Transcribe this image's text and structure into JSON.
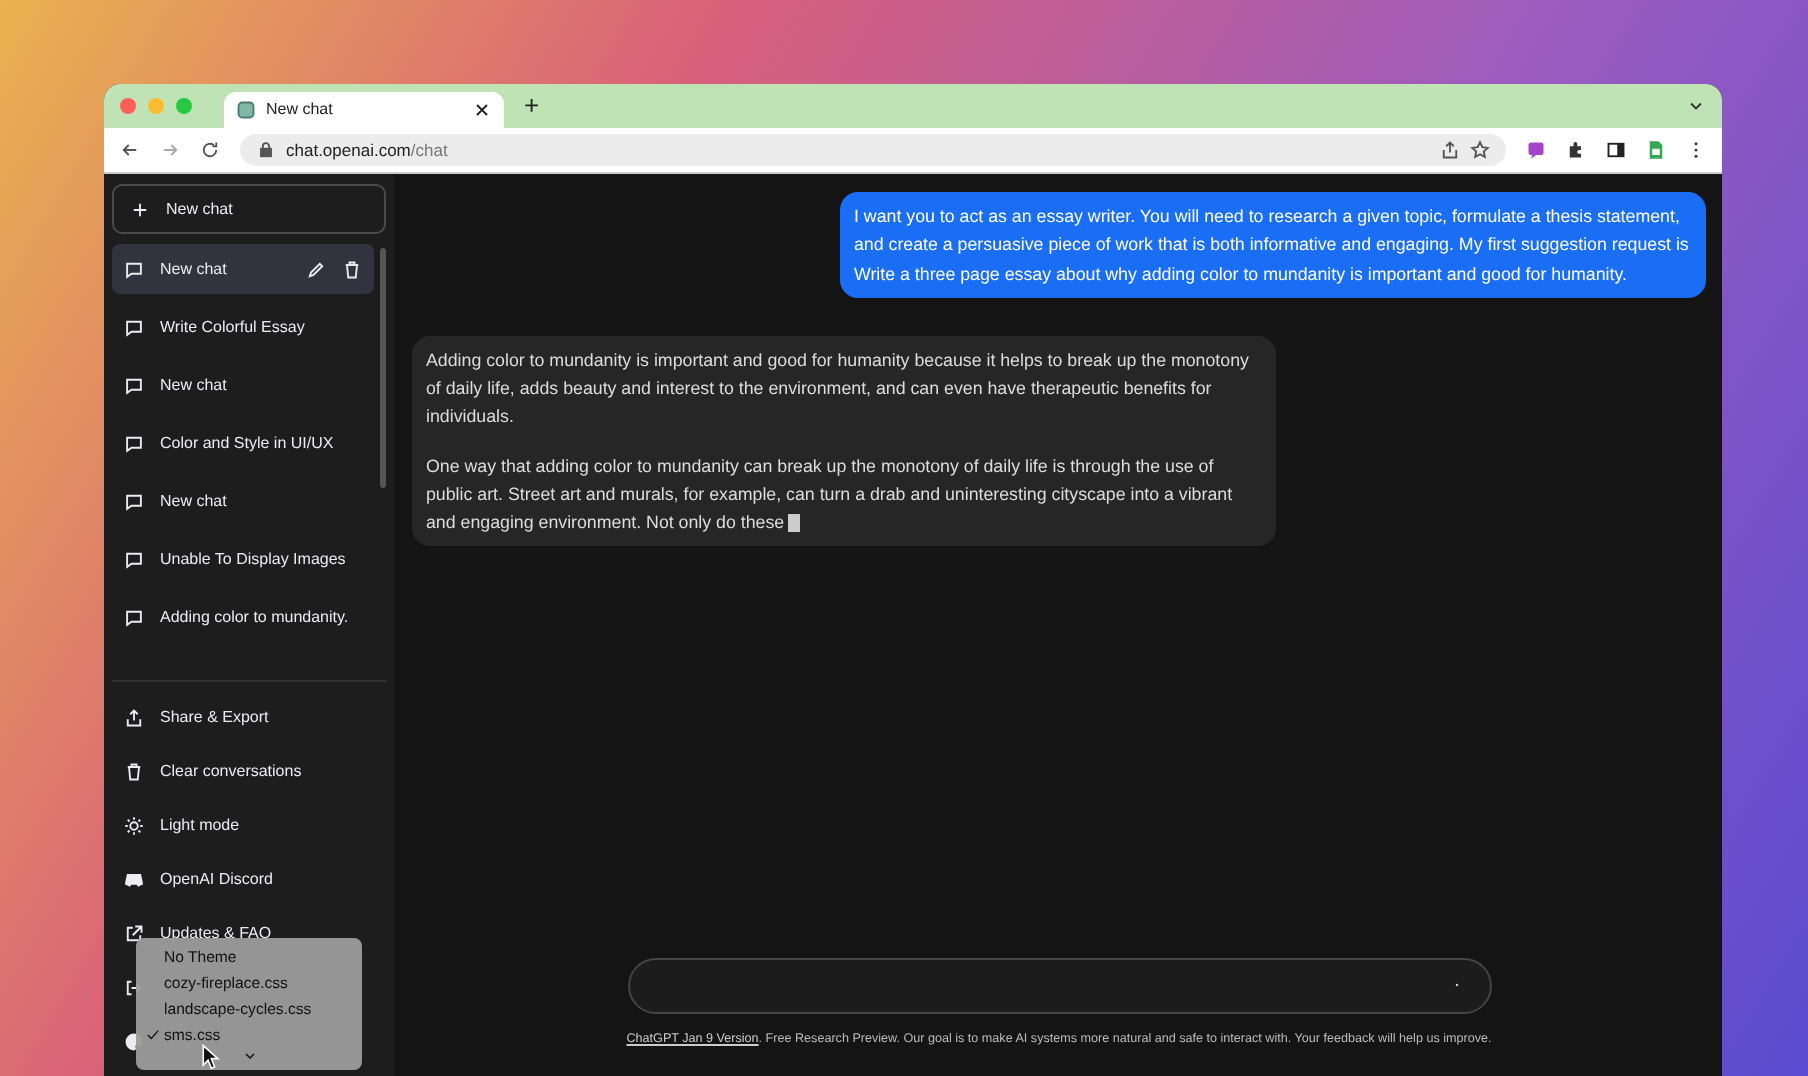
{
  "browser": {
    "tab_title": "New chat",
    "new_tab": "+",
    "url_host": "chat.openai.com",
    "url_path": "/chat"
  },
  "sidebar": {
    "new_chat_button": "New chat",
    "chats": [
      {
        "title": "New chat",
        "selected": true
      },
      {
        "title": "Write Colorful Essay",
        "selected": false
      },
      {
        "title": "New chat",
        "selected": false
      },
      {
        "title": "Color and Style in UI/UX",
        "selected": false
      },
      {
        "title": "New chat",
        "selected": false
      },
      {
        "title": "Unable To Display Images",
        "selected": false
      },
      {
        "title": "Adding color to mundanity.",
        "selected": false
      }
    ],
    "menu": [
      {
        "kind": "share",
        "label": "Share & Export"
      },
      {
        "kind": "trash",
        "label": "Clear conversations"
      },
      {
        "kind": "sun",
        "label": "Light mode"
      },
      {
        "kind": "discord",
        "label": "OpenAI Discord"
      },
      {
        "kind": "link",
        "label": "Updates & FAQ"
      },
      {
        "kind": "logout"
      },
      {
        "kind": "palette"
      }
    ]
  },
  "theme_menu": {
    "options": [
      {
        "label": "No Theme",
        "selected": false
      },
      {
        "label": "cozy-fireplace.css",
        "selected": false
      },
      {
        "label": "landscape-cycles.css",
        "selected": false
      },
      {
        "label": "sms.css",
        "selected": true
      }
    ]
  },
  "messages": [
    {
      "kind": "user",
      "typing": false,
      "paragraphs": [
        "I want you to act as an essay writer. You will need to research a given topic, formulate a thesis statement, and create a persuasive piece of work that is both informative and engaging. My first suggestion request is Write a three page essay about why adding color to mundanity is important and good for humanity."
      ]
    },
    {
      "kind": "assistant",
      "typing": true,
      "paragraphs": [
        "Adding color to mundanity is important and good for humanity because it helps to break up the monotony of daily life, adds beauty and interest to the environment, and can even have therapeutic benefits for individuals.",
        "One way that adding color to mundanity can break up the monotony of daily life is through the use of public art. Street art and murals, for example, can turn a drab and uninteresting cityscape into a vibrant and engaging environment. Not only do these"
      ]
    }
  ],
  "footer": {
    "link": "ChatGPT Jan 9 Version",
    "text": ". Free Research Preview. Our goal is to make AI systems more natural and safe to interact with. Your feedback will help us improve."
  }
}
